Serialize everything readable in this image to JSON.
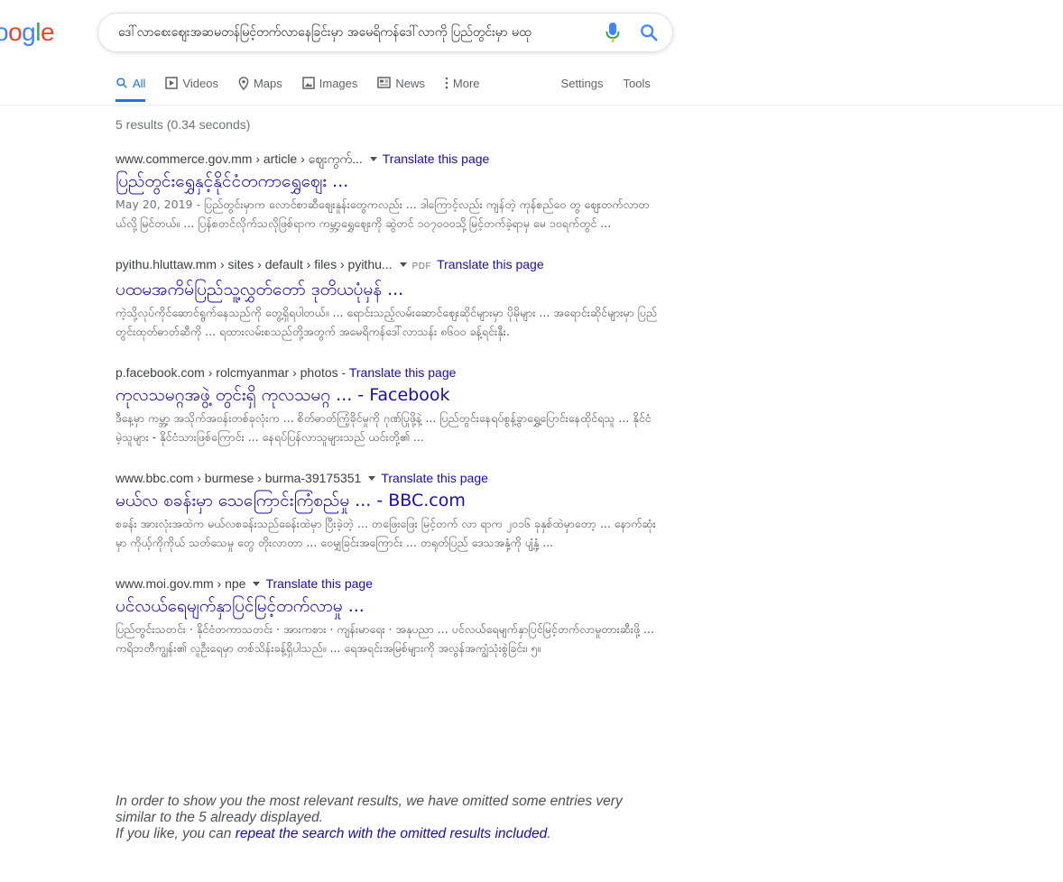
{
  "logo": {
    "text": "oogle",
    "letters": [
      {
        "char": "o",
        "color": "#4285f4"
      },
      {
        "char": "o",
        "color": "#ea4335"
      },
      {
        "char": "g",
        "color": "#4285f4"
      },
      {
        "char": "l",
        "color": "#34a853"
      },
      {
        "char": "e",
        "color": "#ea4335"
      }
    ],
    "G_color": "#4285f4"
  },
  "search": {
    "query": "ဒေါ်လာစေးဈေးအဆမတန်မြင့်တက်လာနေခြင်းမှာ အမေရိကန်ဒေါ်လာကို ပြည်တွင်းမှာ မထု"
  },
  "tabs": [
    {
      "label": "All",
      "icon": "search-icon",
      "active": true
    },
    {
      "label": "Videos",
      "icon": "video-icon"
    },
    {
      "label": "Maps",
      "icon": "map-pin-icon"
    },
    {
      "label": "Images",
      "icon": "image-icon"
    },
    {
      "label": "News",
      "icon": "news-icon"
    },
    {
      "label": "More",
      "icon": "more-vert-icon"
    }
  ],
  "tools": {
    "settings": "Settings",
    "tools": "Tools"
  },
  "stats": "5 results (0.34 seconds)",
  "results": [
    {
      "cite": "www.commerce.gov.mm › article › ဈေးကွက်...",
      "translate": "Translate this page",
      "title": "ပြည်တွင်းရွှေနှင့်နိုင်ငံတကာရွှေဈေး ...",
      "date": "May 20, 2019 - ",
      "snippet": "ပြည်တွင်းမှာက လောင်စာဆီဈေးနှုန်းတွေကလည်း ... ဒါကြောင့်လည်း ကျန်တဲ့ ကုန်စည်ဝေ တွ ဈေးတက်လာတယ်လို့မြင်တယ်။ ... ပြန်စတင်လိုက်သလိုဖြစ်ရာက ကမ္ဘာ့ရွှေဈေးကို ဆွဲတင် ၁၀၇၀၀၀သို့မြင့်တက်ခဲ့ရာမှ မေ ၁၀ရက်တွင် ..."
    },
    {
      "cite": "pyithu.hluttaw.mm › sites › default › files › pyithu...",
      "pdf": "PDF",
      "translate": "Translate this page",
      "title": "ပထမအကိမ်ပြည်သူ့လွှတ်တော် ဒုတိယပုံမှန် ...",
      "snippet": "ကဲ့သို့လုပ်ကိုင်ဆောင်ရွက်နေသည်ကို တွေ့ရှိရပါတယ်။ ... ရောင်းသည့်လမ်းဆောင်ဈေးဆိုင်များမှာ ပိုမိုများ ... အရောင်းဆိုင်များမှာ ပြည်တွင်းထုတ်ဓာတ်ဆီကို ... ရထားလမ်းစသည်တို့အတွက် အမေရိကန်ဒေါ်လာသန်း ၈၆၀၀ ခန့်ရင်းနှီး."
    },
    {
      "cite": "p.facebook.com › rolcmyanmar › photos",
      "translate": "Translate this page",
      "title": "ကုလသမဂ္ဂအဖွဲ့ တွင်းရှိ ကုလသမဂ္ဂ ... - Facebook",
      "snippet": "ဒီနေ့မှာ ကမ္ဘာ့ အသိုက်အဝန်းတစ်ခုလုံးက ... စိတ်ဓာတ်ကြံ့ခိုင်မှုကို ဂုဏ်ပြုဖို့နဲ့ ... ပြည်တွင်းနေရပ်စွန့်ခွာရွှေ့ပြောင်းနေထိုင်ရသူ ... နိုင်ငံမဲ့သူများ - နိုင်ငံသားဖြစ်ကြောင်း ... နေရပ်ပြန်လာသူများသည် ယင်းတို့၏ ..."
    },
    {
      "cite": "www.bbc.com › burmese › burma-39175351",
      "translate": "Translate this page",
      "title": "မယ်လ စခန်းမှာ သေကြောင်းကြံစည်မှု ... - BBC.com",
      "snippet": "စခန်း အားလုံးအထဲက မယ်လစခန်းသည်ခေန်းထဲမှာ ပြီးခဲ့တဲ့ ... တဖြေးဖြေး မြင့်တက် လာ ရာက ၂၀၁၆ ခုနှစ်ထဲမှာတော့ ... နောက်ဆုံးမှာ ကိုယ့်ကိုကိုယ် သတ်သေမှု တွေ တိုးလာတာ ... ဝေမျှခြင်းအကြောင်း ... တရုတ်ပြည် ဒေသအနှံ့ကို ပျံ့နှံ့ ..."
    },
    {
      "cite": "www.moi.gov.mm › npe",
      "translate": "Translate this page",
      "title": "ပင်လယ်ရေမျက်နှာပြင်မြင့်တက်လာမှု ...",
      "snippet": "ပြည်တွင်းသတင်း · နိုင်ငံတကာသတင်း · အားကစား · ကျန်းမာရေး · အနုပညာ ... ပင်လယ်ရေမျက်နှာပြင်မြင့်တက်လာမှုတားဆီးဖို့ ... ကရိဘတီကျွန်း၏ လူဦးရေမှာ တစ်သိန်းခန့်ရှိပါသည်။ ... ရေအရင်းအမြစ်များကို အလွန်အကျွံသုံးစွဲခြင်း၊ ၅။"
    }
  ],
  "omitted": {
    "line1": "In order to show you the most relevant results, we have omitted some entries very similar to the 5 already displayed.",
    "line2_prefix": "If you like, you can ",
    "link": "repeat the search with the omitted results included",
    "line2_suffix": "."
  },
  "colors": {
    "link": "#1a0dab",
    "accent": "#1a73e8",
    "mic_blue": "#4285f4",
    "mic_red": "#ea4335"
  }
}
